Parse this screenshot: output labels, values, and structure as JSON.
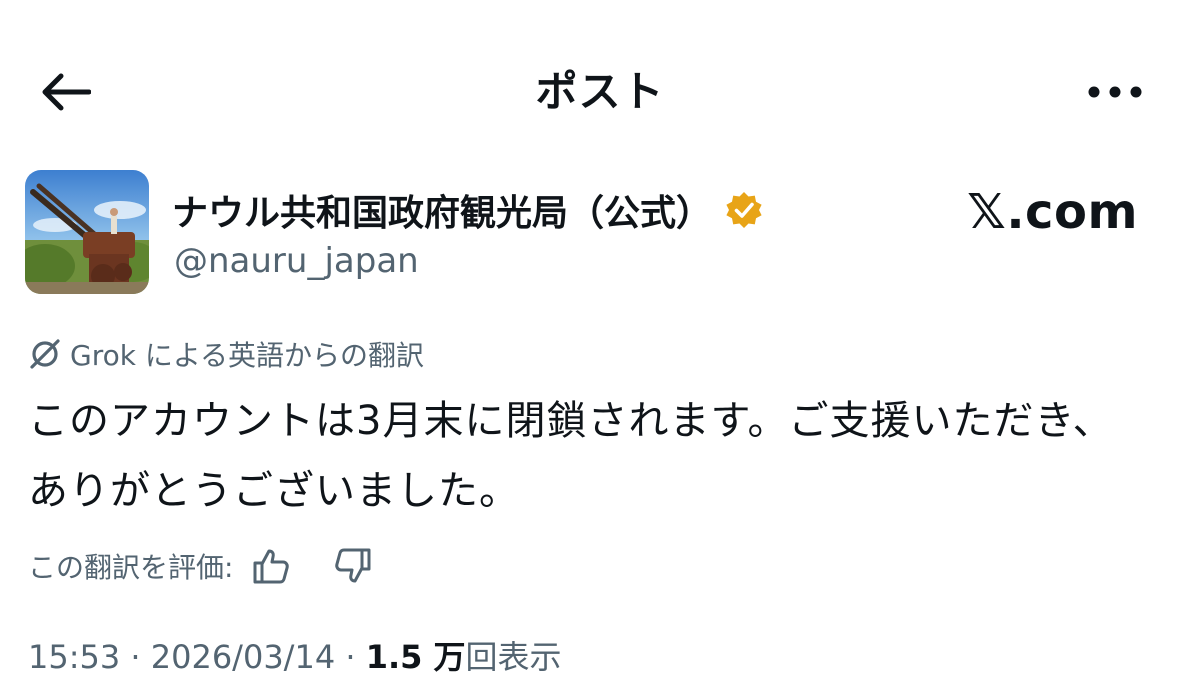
{
  "header": {
    "title": "ポスト",
    "back_icon": "arrow-left-icon",
    "more_icon": "more-horizontal-icon"
  },
  "author": {
    "display_name": "ナウル共和国政府観光局（公式）",
    "handle": "@nauru_japan",
    "verified_badge": "verified-gold-badge-icon",
    "verified_color": "#f4b400"
  },
  "brand": {
    "label": "𝕏.com"
  },
  "translation": {
    "label": "Grok による英語からの翻訳",
    "icon": "grok-icon"
  },
  "post": {
    "text": "このアカウントは3月末に閉鎖されます。ご支援いただき、ありがとうございました。"
  },
  "rate": {
    "label": "この翻訳を評価:",
    "thumbs_up_icon": "thumbs-up-icon",
    "thumbs_down_icon": "thumbs-down-icon"
  },
  "meta": {
    "time": "15:53",
    "separator": "·",
    "date": "2026/03/14",
    "views_count": "1.5 万",
    "views_label": "回表示"
  },
  "colors": {
    "text_primary": "#0f1419",
    "text_secondary": "#536471",
    "background": "#ffffff"
  }
}
